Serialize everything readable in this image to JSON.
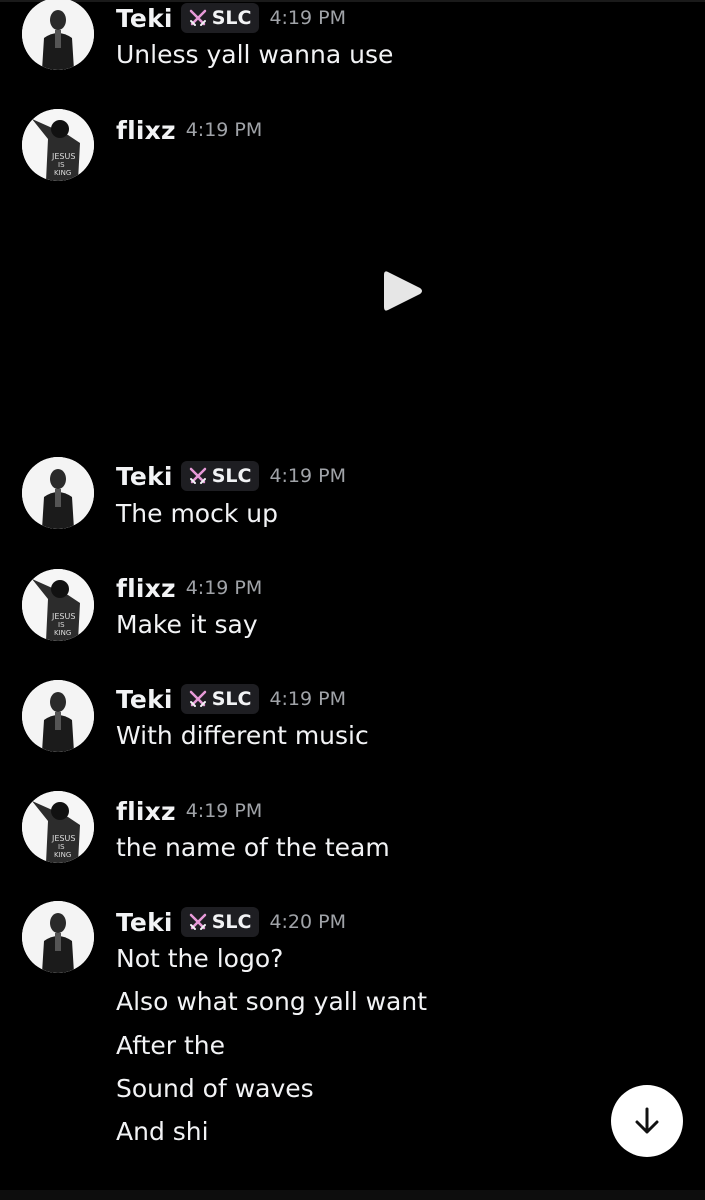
{
  "theme": {
    "background": "#000000",
    "text": "#f2f3f5",
    "muted": "#a0a3a8",
    "tag_bg": "#1e1e22",
    "tag_icon_color": "#e79ad8"
  },
  "messages": [
    {
      "author": "Teki",
      "tag": "SLC",
      "time": "4:19 PM",
      "lines": [
        "Unless yall wanna use"
      ]
    },
    {
      "author": "flixz",
      "time": "4:19 PM",
      "attachment": "video"
    },
    {
      "author": "Teki",
      "tag": "SLC",
      "time": "4:19 PM",
      "lines": [
        "The mock up"
      ]
    },
    {
      "author": "flixz",
      "time": "4:19 PM",
      "lines": [
        "Make it say"
      ]
    },
    {
      "author": "Teki",
      "tag": "SLC",
      "time": "4:19 PM",
      "lines": [
        "With different music"
      ]
    },
    {
      "author": "flixz",
      "time": "4:19 PM",
      "lines": [
        "the name of the team"
      ]
    },
    {
      "author": "Teki",
      "tag": "SLC",
      "time": "4:20 PM",
      "lines": [
        "Not the logo?",
        "Also what song yall want",
        "After the",
        "Sound of waves",
        "And shi"
      ]
    }
  ],
  "icons": {
    "tag_icon": "crossed-swords-icon",
    "play_icon": "play-icon",
    "scroll_icon": "arrow-down-icon"
  }
}
